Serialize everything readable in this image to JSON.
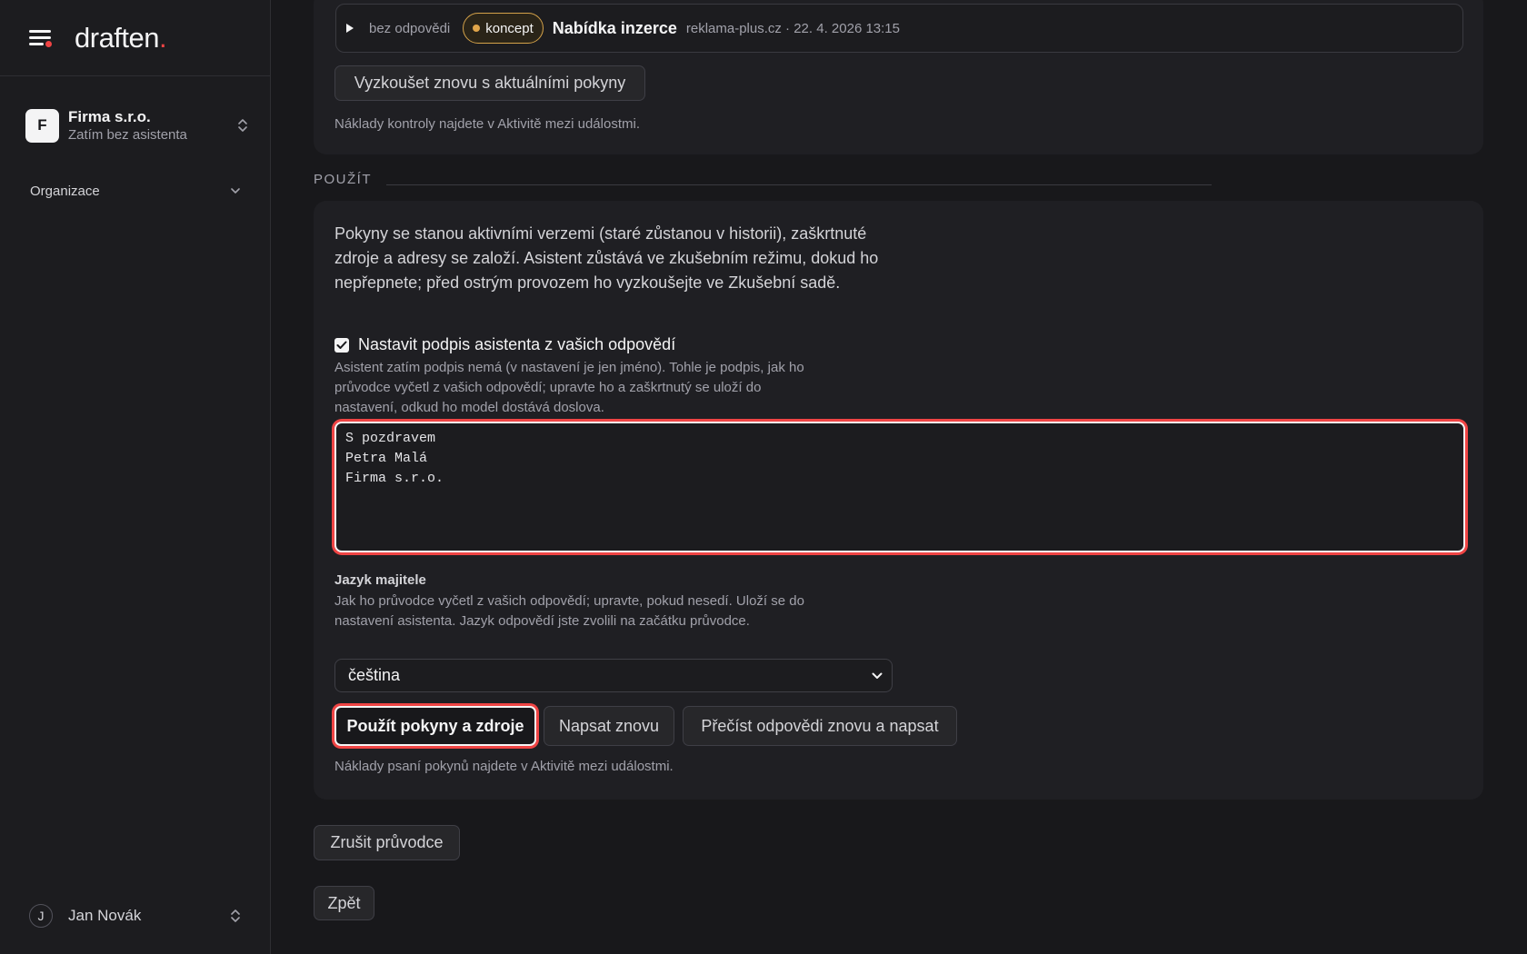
{
  "brand": {
    "name": "draften",
    "dot": "."
  },
  "sidebar": {
    "org": {
      "initial": "F",
      "name": "Firma s.r.o.",
      "subtitle": "Zatím bez asistenta"
    },
    "nav": {
      "label": "Organizace"
    },
    "user": {
      "initial": "J",
      "name": "Jan Novák"
    }
  },
  "review": {
    "row": {
      "status": "bez odpovědi",
      "badge": "koncept",
      "title": "Nabídka inzerce",
      "meta": "reklama-plus.cz · 22. 4. 2026 13:15"
    },
    "retry_label": "Vyzkoušet znovu s aktuálními pokyny",
    "cost_note": "Náklady kontroly najdete v Aktivitě mezi událostmi."
  },
  "apply": {
    "section_title": "POUŽÍT",
    "description": "Pokyny se stanou aktivními verzemi (staré zůstanou v historii), zaškrtnuté zdroje a adresy se založí. Asistent zůstává ve zkušebním režimu, dokud ho nepřepnete; před ostrým provozem ho vyzkoušejte ve Zkušební sadě.",
    "signature": {
      "checked": true,
      "label": "Nastavit podpis asistenta z vašich odpovědí",
      "help": "Asistent zatím podpis nemá (v nastavení je jen jméno). Tohle je podpis, jak ho průvodce vyčetl z vašich odpovědí; upravte ho a zaškrtnutý se uloží do nastavení, odkud ho model dostává doslova.",
      "value": "S pozdravem\nPetra Malá\nFirma s.r.o."
    },
    "language": {
      "label": "Jazyk majitele",
      "help": "Jak ho průvodce vyčetl z vašich odpovědí; upravte, pokud nesedí. Uloží se do nastavení asistenta. Jazyk odpovědí jste zvolili na začátku průvodce.",
      "selected": "čeština"
    },
    "buttons": {
      "apply": "Použít pokyny a zdroje",
      "rewrite": "Napsat znovu",
      "reread": "Přečíst odpovědi znovu a napsat"
    },
    "cost_note": "Náklady psaní pokynů najdete v Aktivitě mezi událostmi."
  },
  "footer": {
    "cancel_label": "Zrušit průvodce",
    "back_label": "Zpět"
  }
}
